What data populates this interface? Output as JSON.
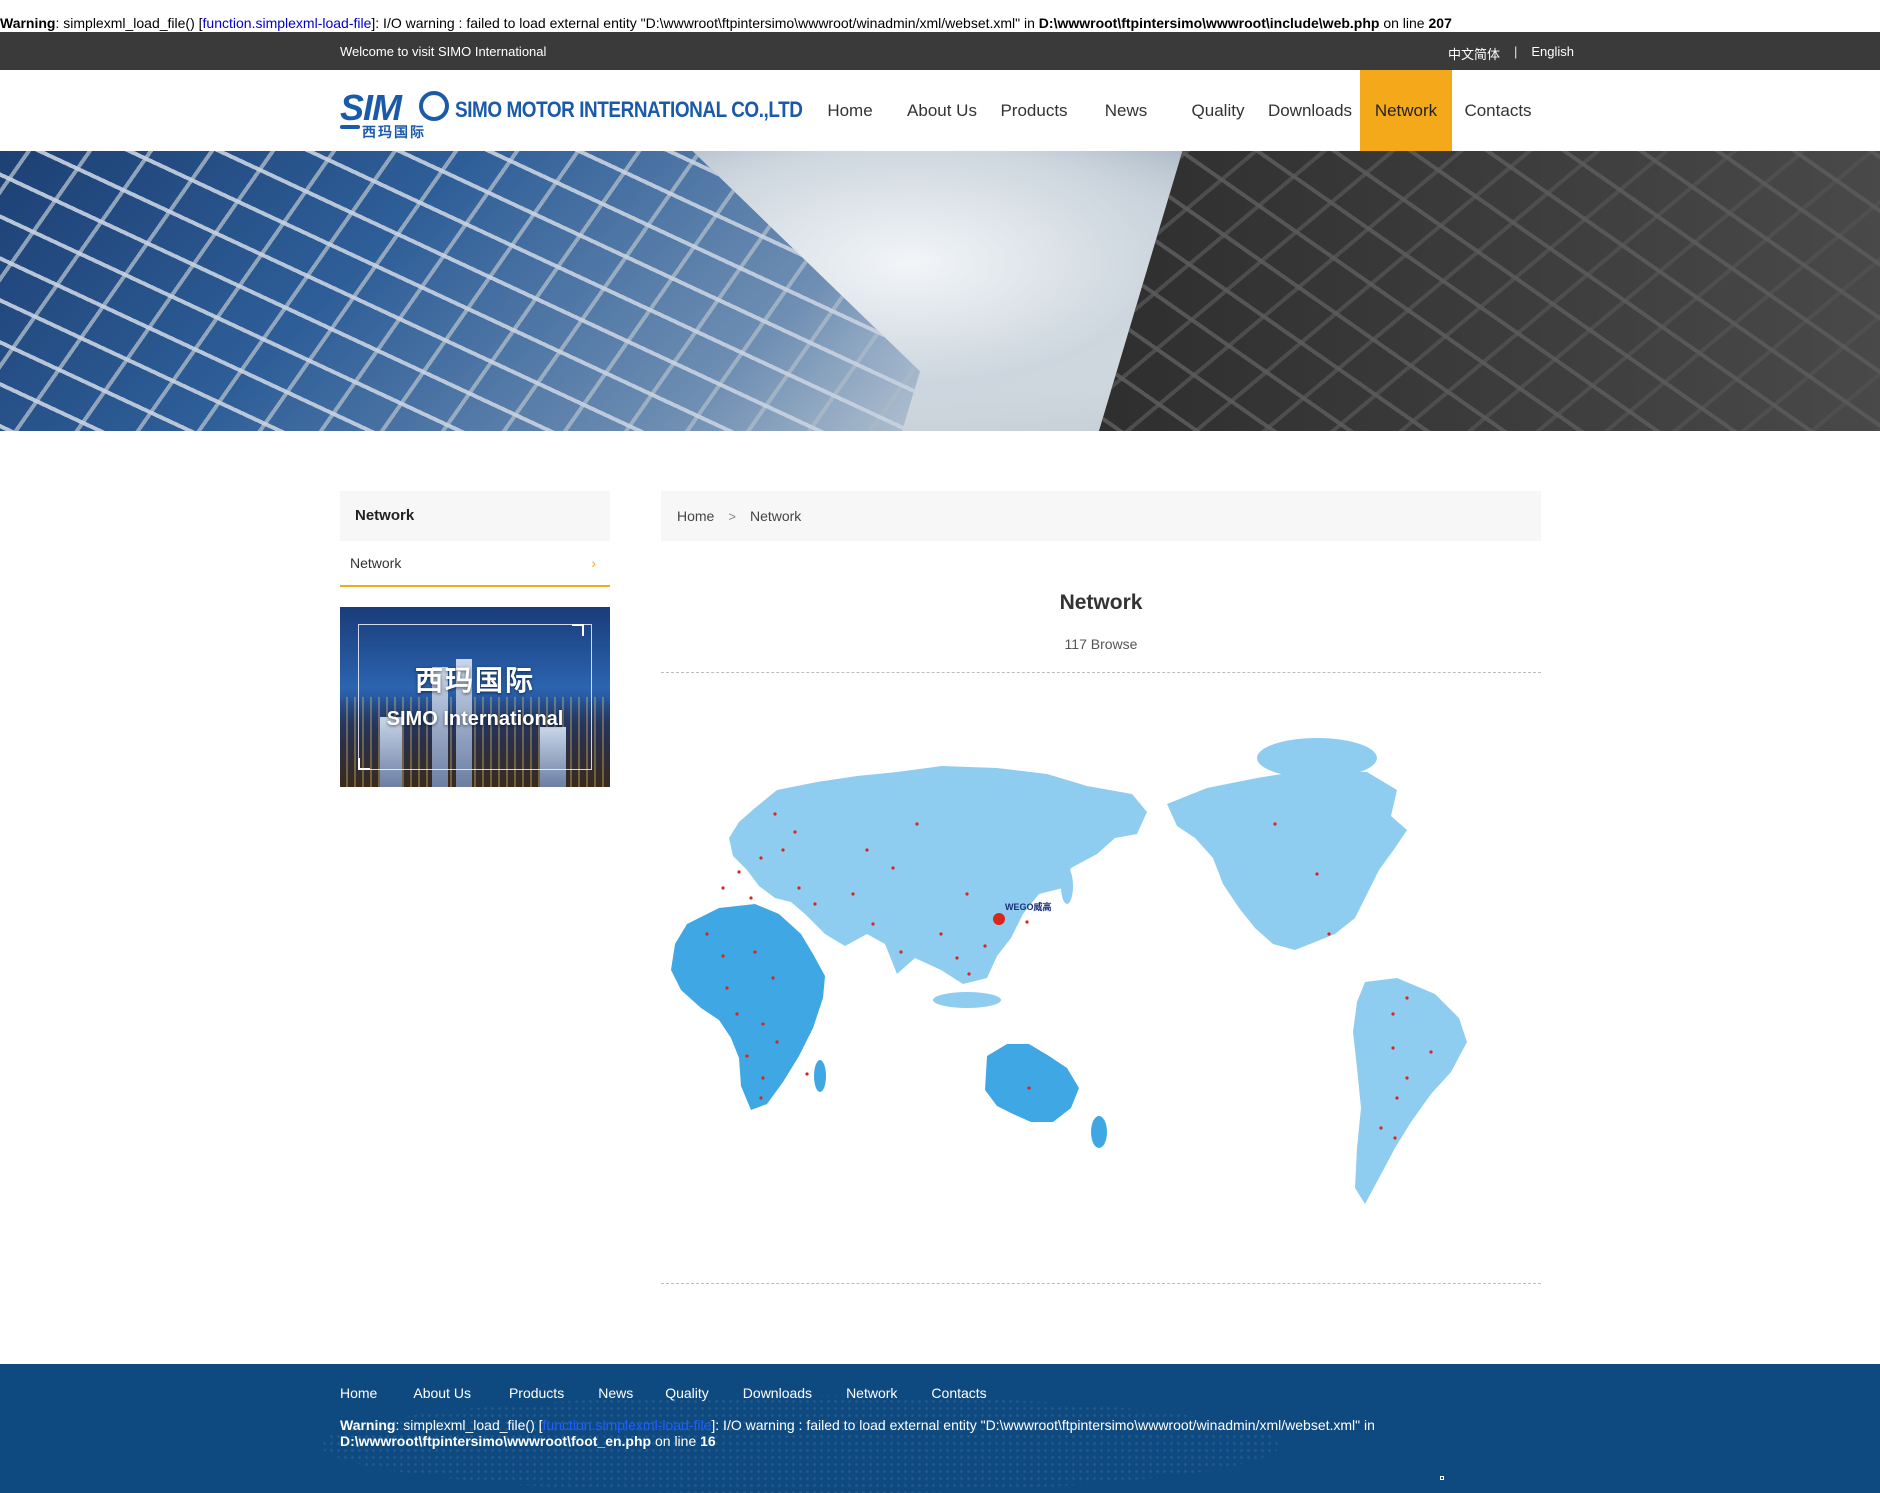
{
  "php_warning_top": {
    "label": "Warning",
    "pre": ": simplexml_load_file() [",
    "link": "function.simplexml-load-file",
    "mid": "]: I/O warning : failed to load external entity \"D:\\wwwroot\\ftpintersimo\\wwwroot/winadmin/xml/webset.xml\" in ",
    "path": "D:\\wwwroot\\ftpintersimo\\wwwroot\\include\\web.php",
    "online": " on line ",
    "line": "207"
  },
  "topbar": {
    "welcome": "Welcome to visit SIMO International",
    "lang_cn": "中文简体",
    "lang_sep": "|",
    "lang_en": "English"
  },
  "logo": {
    "mark": "SIM",
    "cn": "西玛国际",
    "company": "SIMO MOTOR INTERNATIONAL CO.,LTD"
  },
  "nav": [
    {
      "label": "Home",
      "active": false
    },
    {
      "label": "About Us",
      "active": false
    },
    {
      "label": "Products",
      "active": false
    },
    {
      "label": "News",
      "active": false
    },
    {
      "label": "Quality",
      "active": false
    },
    {
      "label": "Downloads",
      "active": false
    },
    {
      "label": "Network",
      "active": true
    },
    {
      "label": "Contacts",
      "active": false
    }
  ],
  "colors": {
    "accent": "#f4a91a",
    "topbar": "#3a3a3a",
    "footer": "#0e4a80",
    "map_land": "#8fcdf0",
    "map_land_dark": "#3fa8e4"
  },
  "sidebar": {
    "title": "Network",
    "item": "Network",
    "chevron": "›",
    "promo_cn": "西玛国际",
    "promo_en": "SIMO International"
  },
  "breadcrumb": {
    "home": "Home",
    "sep": ">",
    "current": "Network"
  },
  "article": {
    "title": "Network",
    "views": "117 Browse"
  },
  "map": {
    "brand": "WEGO威高"
  },
  "footer": {
    "nav": [
      "Home",
      "About Us",
      "Products",
      "News",
      "Quality",
      "Downloads",
      "Network",
      "Contacts"
    ],
    "warning": {
      "label": "Warning",
      "pre": ": simplexml_load_file() [",
      "link": "function.simplexml-load-file",
      "mid": "]: I/O warning : failed to load external entity \"D:\\wwwroot\\ftpintersimo\\wwwroot/winadmin/xml/webset.xml\" in ",
      "path": "D:\\wwwroot\\ftpintersimo\\wwwroot\\foot_en.php",
      "online": " on line ",
      "line": "16"
    }
  }
}
